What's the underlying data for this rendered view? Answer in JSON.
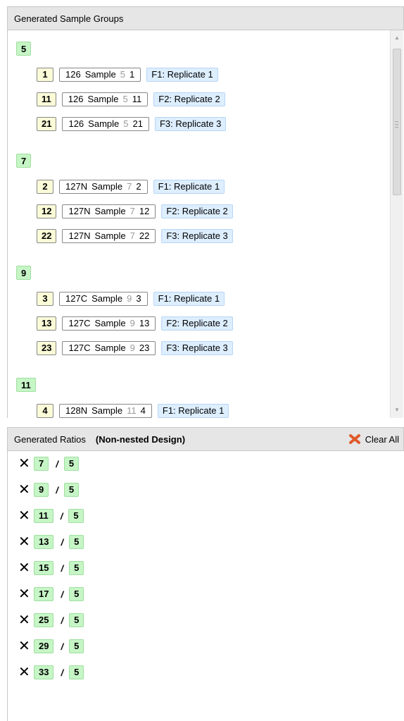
{
  "groups_panel": {
    "title": "Generated Sample Groups"
  },
  "groups": [
    {
      "label": "5",
      "rows": [
        {
          "index": "1",
          "channel": "126",
          "sample": "Sample",
          "group": "5",
          "num": "1",
          "replicate": "F1: Replicate 1"
        },
        {
          "index": "11",
          "channel": "126",
          "sample": "Sample",
          "group": "5",
          "num": "11",
          "replicate": "F2: Replicate 2"
        },
        {
          "index": "21",
          "channel": "126",
          "sample": "Sample",
          "group": "5",
          "num": "21",
          "replicate": "F3: Replicate 3"
        }
      ]
    },
    {
      "label": "7",
      "rows": [
        {
          "index": "2",
          "channel": "127N",
          "sample": "Sample",
          "group": "7",
          "num": "2",
          "replicate": "F1: Replicate 1"
        },
        {
          "index": "12",
          "channel": "127N",
          "sample": "Sample",
          "group": "7",
          "num": "12",
          "replicate": "F2: Replicate 2"
        },
        {
          "index": "22",
          "channel": "127N",
          "sample": "Sample",
          "group": "7",
          "num": "22",
          "replicate": "F3: Replicate 3"
        }
      ]
    },
    {
      "label": "9",
      "rows": [
        {
          "index": "3",
          "channel": "127C",
          "sample": "Sample",
          "group": "9",
          "num": "3",
          "replicate": "F1: Replicate 1"
        },
        {
          "index": "13",
          "channel": "127C",
          "sample": "Sample",
          "group": "9",
          "num": "13",
          "replicate": "F2: Replicate 2"
        },
        {
          "index": "23",
          "channel": "127C",
          "sample": "Sample",
          "group": "9",
          "num": "23",
          "replicate": "F3: Replicate 3"
        }
      ]
    },
    {
      "label": "11",
      "rows": [
        {
          "index": "4",
          "channel": "128N",
          "sample": "Sample",
          "group": "11",
          "num": "4",
          "replicate": "F1: Replicate 1"
        }
      ]
    }
  ],
  "ratios_panel": {
    "title": "Generated Ratios",
    "design": "(Non-nested Design)",
    "clear_all": "Clear All"
  },
  "ratios": [
    {
      "numerator": "7",
      "denominator": "5"
    },
    {
      "numerator": "9",
      "denominator": "5"
    },
    {
      "numerator": "11",
      "denominator": "5"
    },
    {
      "numerator": "13",
      "denominator": "5"
    },
    {
      "numerator": "15",
      "denominator": "5"
    },
    {
      "numerator": "17",
      "denominator": "5"
    },
    {
      "numerator": "25",
      "denominator": "5"
    },
    {
      "numerator": "29",
      "denominator": "5"
    },
    {
      "numerator": "33",
      "denominator": "5"
    }
  ],
  "ratio_separator": "/",
  "remove_glyph": "✕",
  "colors": {
    "group_badge": "#c6f5c6",
    "sample_badge": "#fbfbd8",
    "replicate_badge": "#ddeeff",
    "header_bg": "#e6e6e6"
  }
}
